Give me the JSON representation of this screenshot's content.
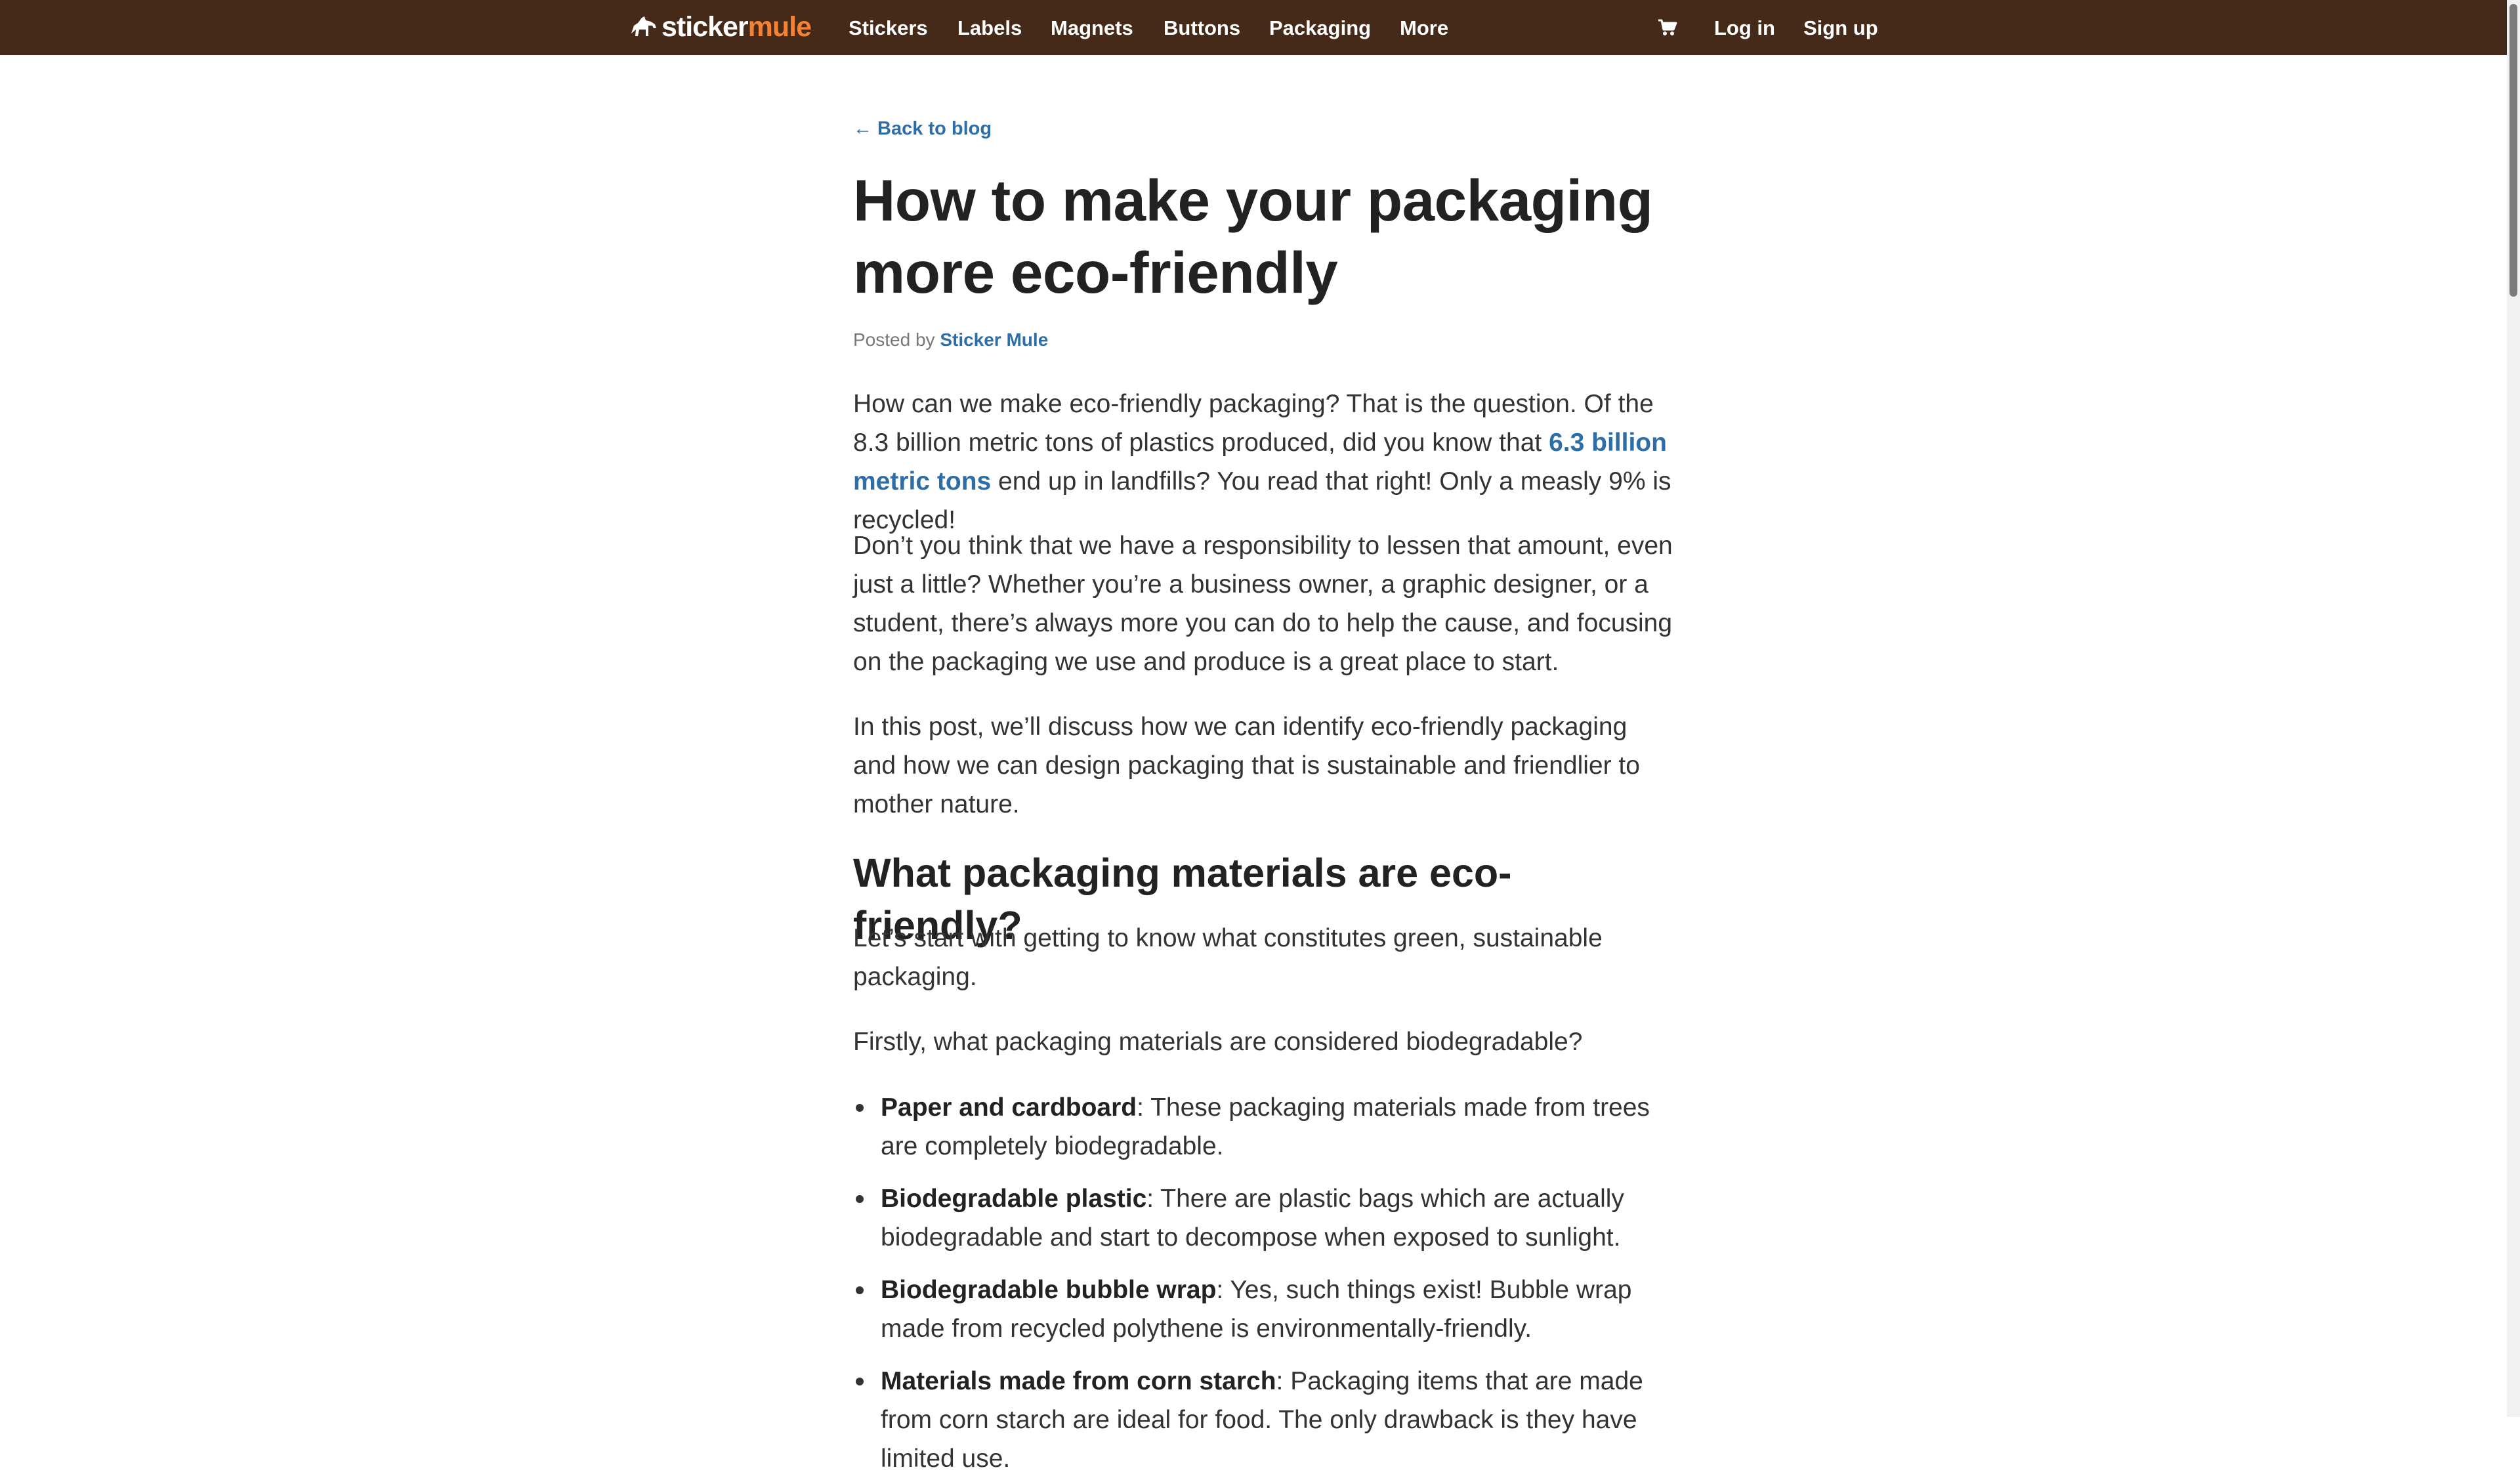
{
  "nav": {
    "logo_sticker": "sticker",
    "logo_mule": "mule",
    "items": [
      "Stickers",
      "Labels",
      "Magnets",
      "Buttons",
      "Packaging",
      "More"
    ],
    "login": "Log in",
    "signup": "Sign up"
  },
  "article": {
    "back_link": "← Back to blog",
    "title": "How to make your packaging more eco-friendly",
    "posted_by": "Posted by",
    "author": "Sticker Mule",
    "p1_a": "How can we make eco-friendly packaging? That is the question. Of the 8.3 billion metric tons of plastics produced, did you know that ",
    "p1_link": "6.3 billion metric tons",
    "p1_b": " end up in landfills? You read that right! Only a measly 9% is recycled!",
    "p2": "Don’t you think that we have a responsibility to lessen that amount, even just a little? Whether you’re a business owner, a graphic designer, or a student, there’s always more you can do to help the cause, and focusing on the packaging we use and produce is a great place to start.",
    "p3": "In this post, we’ll discuss how we can identify eco-friendly packaging and how we can design packaging that is sustainable and friendlier to mother nature.",
    "h2": "What packaging materials are eco-friendly?",
    "p4": "Let’s start with getting to know what constitutes green, sustainable packaging.",
    "p5": "Firstly, what packaging materials are considered biodegradable?",
    "list": [
      {
        "term": "Paper and cardboard",
        "desc": ": These packaging materials made from trees are completely biodegradable."
      },
      {
        "term": "Biodegradable plastic",
        "desc": ": There are plastic bags which are actually biodegradable and start to decompose when exposed to sunlight."
      },
      {
        "term": "Biodegradable bubble wrap",
        "desc": ": Yes, such things exist! Bubble wrap made from recycled polythene is environmentally-friendly."
      },
      {
        "term": "Materials made from corn starch",
        "desc": ": Packaging items that are made from corn starch are ideal for food. The only drawback is they have limited use."
      }
    ]
  },
  "colors": {
    "nav_bg": "#452919",
    "brand_orange": "#f58233",
    "link": "#2e6ea8"
  }
}
